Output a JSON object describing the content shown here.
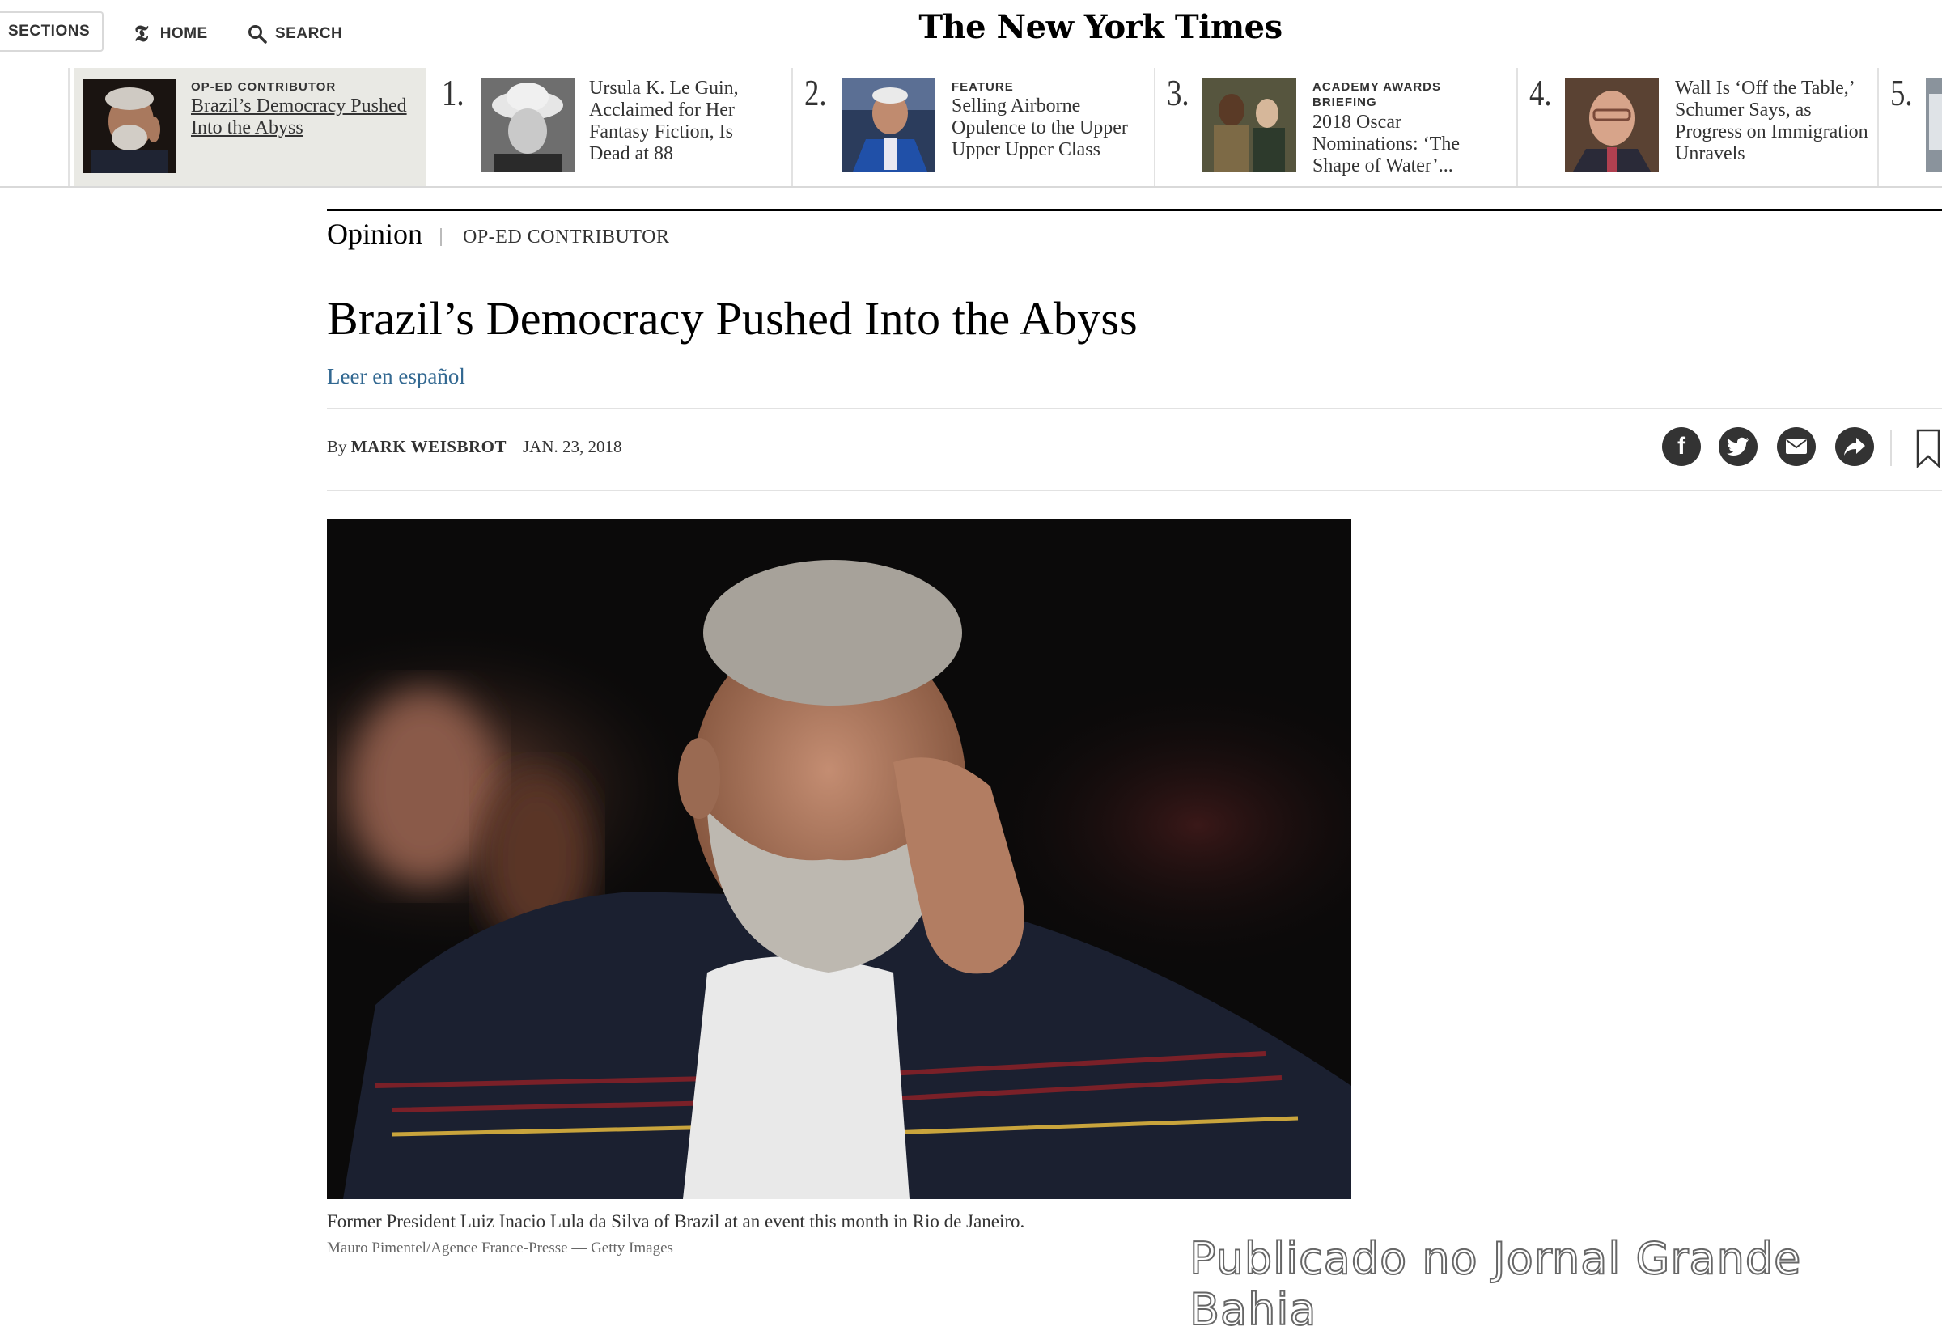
{
  "masthead": {
    "sections_label": "SECTIONS",
    "home_label": "HOME",
    "search_label": "SEARCH",
    "logo_text": "The New York Times"
  },
  "ribbon": {
    "current": {
      "kicker": "OP-ED CONTRIBUTOR",
      "headline": "Brazil’s Democracy Pushed Into the Abyss"
    },
    "items": [
      {
        "number": "1.",
        "kicker": "",
        "headline": "Ursula K. Le Guin, Acclaimed for Her Fantasy Fiction, Is Dead at 88"
      },
      {
        "number": "2.",
        "kicker": "FEATURE",
        "headline": "Selling Airborne Opulence to the Upper Upper Upper Class"
      },
      {
        "number": "3.",
        "kicker": "ACADEMY AWARDS BRIEFING",
        "headline": "2018 Oscar Nominations: ‘The Shape of Water’..."
      },
      {
        "number": "4.",
        "kicker": "",
        "headline": "Wall Is ‘Off the Table,’ Schumer Says, as Progress on Immigration Unravels"
      },
      {
        "number": "5.",
        "kicker": "",
        "headline": ""
      }
    ]
  },
  "article": {
    "section": "Opinion",
    "kicker": "OP-ED CONTRIBUTOR",
    "headline": "Brazil’s Democracy Pushed Into the Abyss",
    "translation_link": "Leer en español",
    "byline_prefix": "By",
    "author": "MARK WEISBROT",
    "date": "JAN. 23, 2018",
    "share": {
      "icons": [
        "facebook-icon",
        "twitter-icon",
        "email-icon",
        "share-icon",
        "bookmark-icon"
      ]
    },
    "image": {
      "caption": "Former President Luiz Inacio Lula da Silva of Brazil at an event this month in Rio de Janeiro.",
      "credit": "Mauro Pimentel/Agence France-Presse — Getty Images"
    }
  },
  "watermark": "Publicado no Jornal Grande Bahia",
  "colors": {
    "link": "#326891",
    "text": "#121212",
    "ribbon_current_bg": "#e9e9e4",
    "icon_bg": "#333333"
  }
}
